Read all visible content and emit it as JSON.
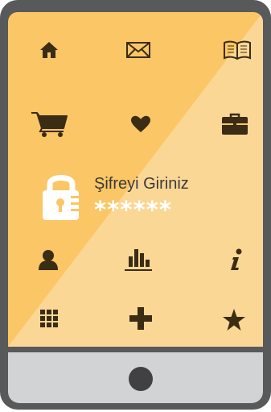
{
  "login": {
    "prompt": "Şifreyi Giriniz",
    "password_mask": "******"
  },
  "icons": [
    [
      "home-icon",
      "mail-icon",
      "book-icon"
    ],
    [
      "shopping-cart-icon",
      "heart-icon",
      "briefcase-icon"
    ],
    [
      "user-icon",
      "bar-chart-icon",
      "info-icon"
    ],
    [
      "grid-icon",
      "plus-icon",
      "star-icon"
    ]
  ],
  "colors": {
    "icon": "#3b2c14",
    "screen_light": "#fbd796",
    "screen_dark": "#fbc665",
    "frame": "#58595b",
    "bezel": "#d1d3d4"
  }
}
